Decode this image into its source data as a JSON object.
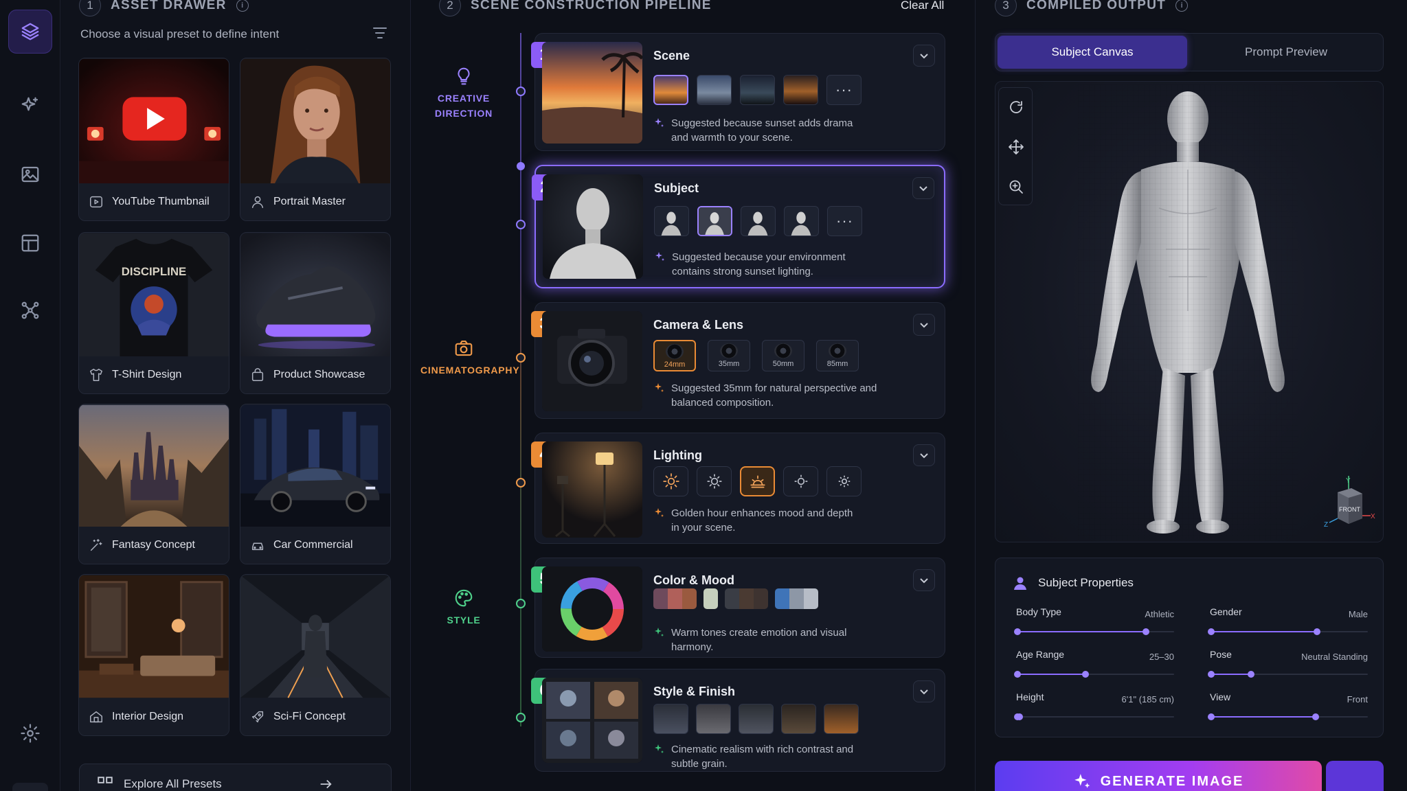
{
  "drawer": {
    "num": "1",
    "title": "ASSET DRAWER",
    "subtitle": "Choose a visual preset to define intent",
    "presets": [
      {
        "label": "YouTube Thumbnail"
      },
      {
        "label": "Portrait Master"
      },
      {
        "label": "T-Shirt Design"
      },
      {
        "label": "Product Showcase"
      },
      {
        "label": "Fantasy Concept"
      },
      {
        "label": "Car Commercial"
      },
      {
        "label": "Interior Design"
      },
      {
        "label": "Sci-Fi Concept"
      }
    ],
    "tshirt_text": "DISCIPLINE",
    "explore_label": "Explore All Presets"
  },
  "pipeline": {
    "num": "2",
    "title": "SCENE CONSTRUCTION PIPELINE",
    "clear_all": "Clear All",
    "groups": {
      "creative": "CREATIVE DIRECTION",
      "cinema": "CINEMATOGRAPHY",
      "style": "STYLE"
    },
    "steps": [
      {
        "num": "1",
        "title": "Scene",
        "more": "···",
        "suggestion": "Suggested because sunset adds drama and warmth to your scene."
      },
      {
        "num": "2",
        "title": "Subject",
        "more": "···",
        "suggestion": "Suggested because your environment contains strong sunset lighting."
      },
      {
        "num": "3",
        "title": "Camera & Lens",
        "lenses": [
          "24mm",
          "35mm",
          "50mm",
          "85mm"
        ],
        "suggestion": "Suggested 35mm for natural perspective and balanced composition."
      },
      {
        "num": "4",
        "title": "Lighting",
        "suggestion": "Golden hour enhances mood and depth in your scene."
      },
      {
        "num": "5",
        "title": "Color & Mood",
        "palettes": [
          [
            "#6e4a5c",
            "#b0605a",
            "#9a5a3f"
          ],
          [
            "#c6d0bd"
          ],
          [
            "#3a3d45",
            "#4a3a32",
            "#3e3330"
          ],
          [
            "#3f74b8",
            "#8d97a6",
            "#b7bdc7"
          ]
        ],
        "suggestion": "Warm tones create emotion and visual harmony."
      },
      {
        "num": "6",
        "title": "Style & Finish",
        "suggestion": "Cinematic realism with rich contrast and subtle grain."
      }
    ]
  },
  "output": {
    "num": "3",
    "title": "COMPILED OUTPUT",
    "tabs": [
      "Subject Canvas",
      "Prompt Preview"
    ],
    "cube_label": "FRONT",
    "axes": {
      "x": "X",
      "y": "Y",
      "z": "Z"
    },
    "props_title": "Subject Properties",
    "props": [
      {
        "key": "Body Type",
        "value": "Athletic",
        "level": 0.82
      },
      {
        "key": "Gender",
        "value": "Male",
        "level": 0.68
      },
      {
        "key": "Age Range",
        "value": "25–30",
        "level": 0.44
      },
      {
        "key": "Pose",
        "value": "Neutral Standing",
        "level": 0.26
      },
      {
        "key": "Height",
        "value": "6'1\" (185 cm)",
        "level": 0.02
      },
      {
        "key": "View",
        "value": "Front",
        "level": 0.67
      }
    ],
    "generate": "GENERATE IMAGE"
  },
  "colors": {
    "accent": "#8b6cff",
    "orange": "#ea8b35",
    "green": "#3ec27a"
  }
}
